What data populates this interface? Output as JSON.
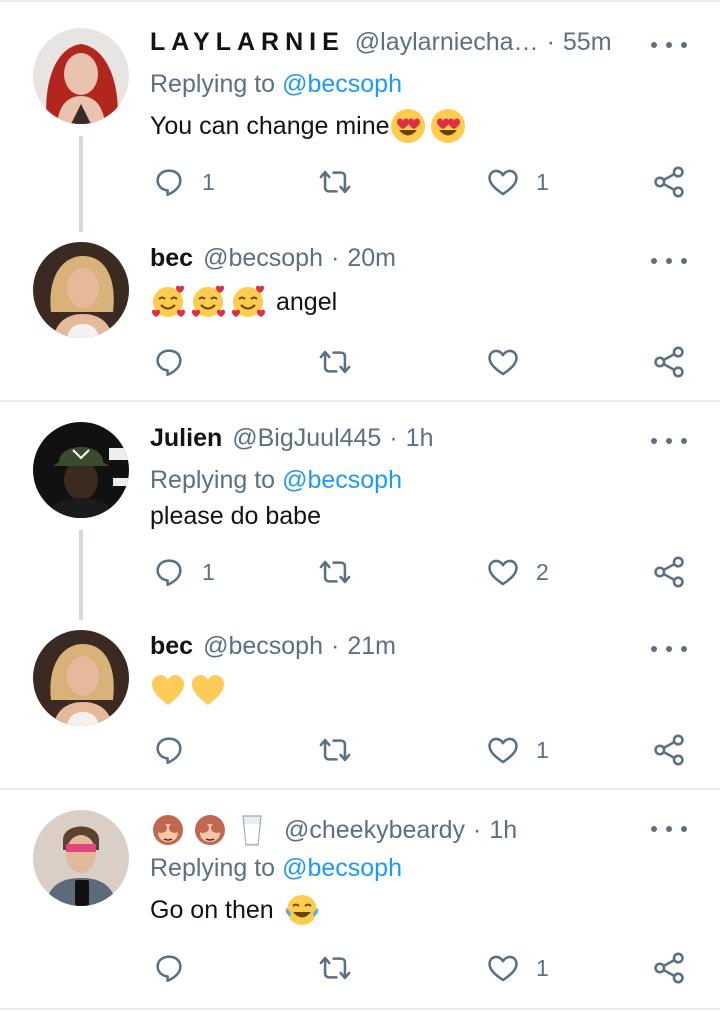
{
  "colors": {
    "text": "#0f1419",
    "secondary": "#5b7083",
    "link": "#1d9bf0",
    "divider": "#e6ecf0",
    "thread": "#cfd9de"
  },
  "tweets": [
    {
      "name": "LAYLARNIE",
      "handle": "@laylarniecha…",
      "time": "55m",
      "replying_label": "Replying to",
      "replying_to": "@becsoph",
      "text": "You can change mine",
      "emojis": [
        "smiling-face-with-heart-eyes",
        "smiling-face-with-heart-eyes"
      ],
      "reply_count": "1",
      "like_count": "1"
    },
    {
      "name": "bec",
      "handle": "@becsoph",
      "time": "20m",
      "text": "angel",
      "emojis": [
        "smiling-face-with-hearts",
        "smiling-face-with-hearts",
        "smiling-face-with-hearts"
      ],
      "reply_count": "",
      "like_count": ""
    },
    {
      "name": "Julien",
      "handle": "@BigJuul445",
      "time": "1h",
      "replying_label": "Replying to",
      "replying_to": "@becsoph",
      "text": "please do babe",
      "reply_count": "1",
      "like_count": "2"
    },
    {
      "name": "bec",
      "handle": "@becsoph",
      "time": "21m",
      "emojis": [
        "yellow-heart",
        "yellow-heart"
      ],
      "reply_count": "",
      "like_count": "1"
    },
    {
      "name_emojis": [
        "see-no-evil-monkey",
        "see-no-evil-monkey",
        "glass-of-milk"
      ],
      "handle": "@cheekybeardy",
      "time": "1h",
      "replying_label": "Replying to",
      "replying_to": "@becsoph",
      "text": "Go on then",
      "emojis": [
        "face-with-tears-of-joy"
      ],
      "reply_count": "",
      "like_count": "1"
    }
  ],
  "separator": "·",
  "icons": {
    "reply": "reply-icon",
    "retweet": "retweet-icon",
    "like": "like-icon",
    "share": "share-icon",
    "more": "more-icon"
  }
}
